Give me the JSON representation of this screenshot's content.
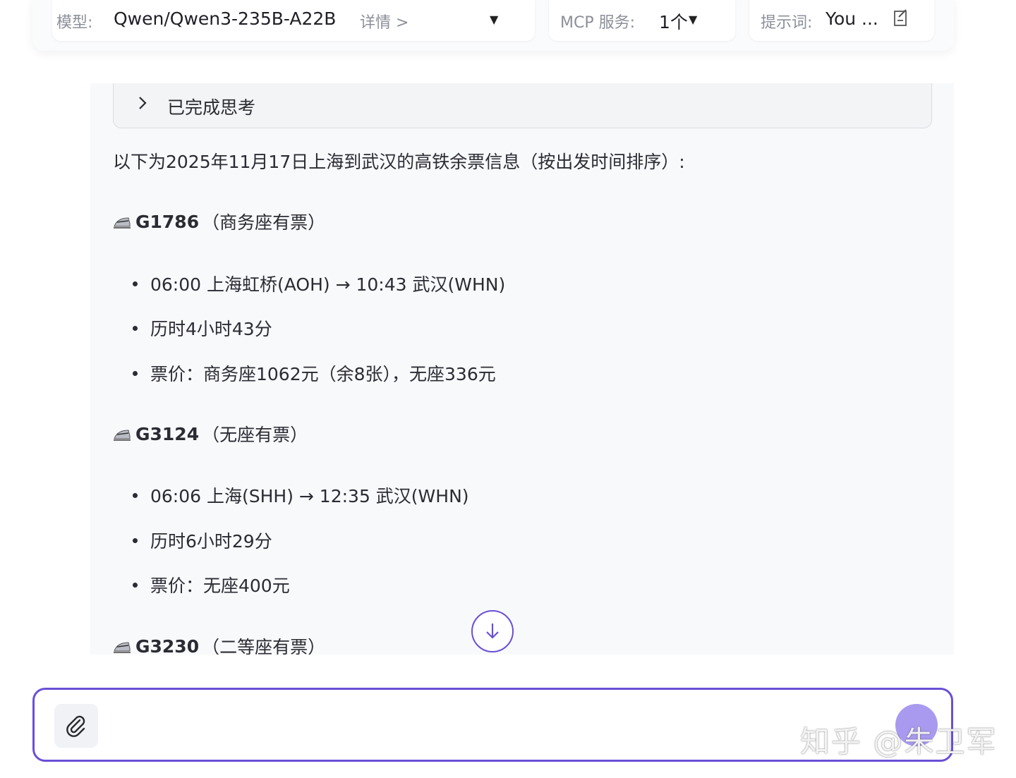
{
  "config": {
    "model": {
      "label": "模型:",
      "value": "Qwen/Qwen3-235B-A22B",
      "details_link": "详情 >"
    },
    "mcp": {
      "label": "MCP 服务:",
      "value": "1个"
    },
    "prompt": {
      "label": "提示词:",
      "value": "You ..."
    }
  },
  "thinking": {
    "label": "已完成思考"
  },
  "intro": "以下为2025年11月17日上海到武汉的高铁余票信息（按出发时间排序）:",
  "trains": [
    {
      "code": "G1786",
      "status": "（商务座有票）",
      "details": [
        "06:00 上海虹桥(AOH) → 10:43 武汉(WHN)",
        "历时4小时43分",
        "票价：商务座1062元（余8张），无座336元"
      ]
    },
    {
      "code": "G3124",
      "status": "（无座有票）",
      "details": [
        "06:06 上海(SHH) → 12:35 武汉(WHN)",
        "历时6小时29分",
        "票价：无座400元"
      ]
    },
    {
      "code": "G3230",
      "status": "（二等座有票）",
      "details": []
    }
  ],
  "composer": {
    "placeholder": ""
  },
  "watermark": "知乎 @朱卫军",
  "colors": {
    "accent": "#6a4fd6",
    "send": "#a99af0"
  }
}
